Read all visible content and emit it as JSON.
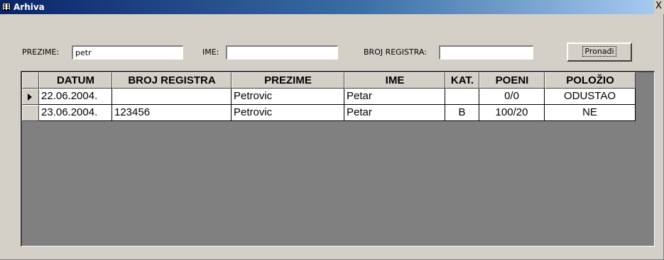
{
  "window": {
    "title": "Arhiva",
    "close_label": "X"
  },
  "search": {
    "prezime_label": "PREZIME:",
    "prezime_value": "petr",
    "ime_label": "IME:",
    "ime_value": "",
    "broj_label": "BROJ REGISTRA:",
    "broj_value": "",
    "button_label": "Pronađi"
  },
  "table": {
    "headers": [
      "DATUM",
      "BROJ REGISTRA",
      "PREZIME",
      "IME",
      "KAT.",
      "POENI",
      "POLOŽIO"
    ],
    "rows": [
      {
        "datum": "22.06.2004.",
        "broj": "",
        "prezime": "Petrovic",
        "ime": "Petar",
        "kat": "",
        "poeni": "0/0",
        "polozio": "ODUSTAO",
        "current": true
      },
      {
        "datum": "23.06.2004.",
        "broj": "123456",
        "prezime": "Petrovic",
        "ime": "Petar",
        "kat": "B",
        "poeni": "100/20",
        "polozio": "NE",
        "current": false
      }
    ]
  },
  "colors": {
    "titlebar_start": "#0a246a",
    "titlebar_end": "#a6caf0",
    "face": "#d4d0c8",
    "grid_background": "#808080"
  }
}
